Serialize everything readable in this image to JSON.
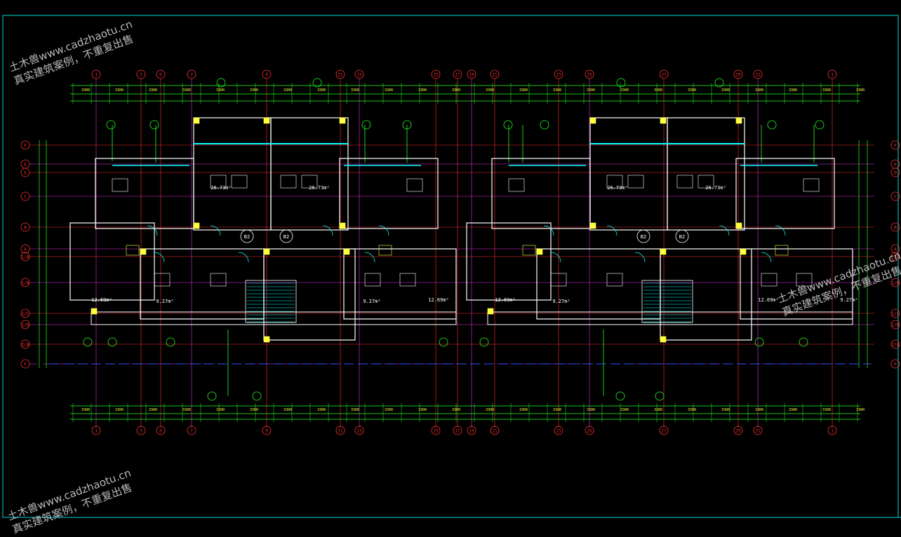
{
  "drawing": {
    "grid_bubbles_top": [
      "1",
      "3",
      "5",
      "7",
      "9",
      "11",
      "13",
      "15",
      "17",
      "19",
      "21",
      "23",
      "25",
      "27",
      "29",
      "31"
    ],
    "grid_bubbles_side": [
      "F",
      "E",
      "D",
      "C",
      "B",
      "A",
      "1/A",
      "1/B",
      "1/C",
      "1/D",
      "2/A"
    ],
    "room_area_labels": [
      "12.69m²",
      "9.27m²",
      "12.69m²",
      "9.27m²",
      "12.69m²",
      "9.27m²",
      "12.69m²",
      "9.27m²",
      "26.73m²",
      "26.73m²",
      "26.73m²",
      "26.73m²"
    ],
    "unit_tags": [
      "B2",
      "B2",
      "B2",
      "B2"
    ],
    "colors": {
      "background": "#000000",
      "frame": "#00d8d8",
      "wall": "#ffffff",
      "axis_red": "#ff3030",
      "axis_magenta": "#e030e0",
      "dim_green": "#20ff20",
      "yellow": "#ffff40",
      "blue": "#3050ff",
      "cyan": "#00ffff"
    }
  },
  "watermark": {
    "line1": "土木兽www.cadzhaotu.cn",
    "line2": "真实建筑案例，不重复出售"
  }
}
